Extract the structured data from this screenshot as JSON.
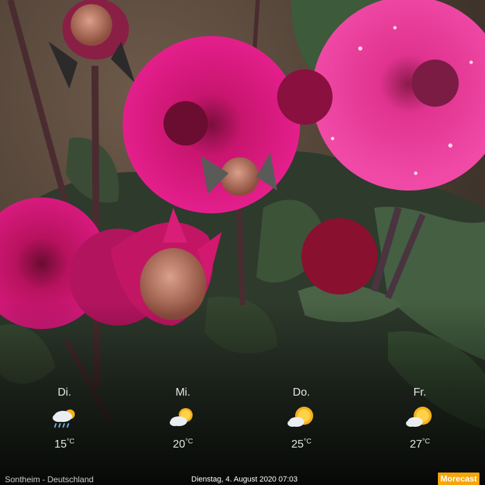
{
  "forecast": [
    {
      "day": "Di.",
      "icon": "cloud-rain-sun-icon",
      "temp": "15",
      "unit": "°C"
    },
    {
      "day": "Mi.",
      "icon": "sun-cloud-icon",
      "temp": "20",
      "unit": "°C"
    },
    {
      "day": "Do.",
      "icon": "sun-cloud-icon",
      "temp": "25",
      "unit": "°C"
    },
    {
      "day": "Fr.",
      "icon": "sun-cloud-icon",
      "temp": "27",
      "unit": "°C"
    }
  ],
  "footer": {
    "location": "Sontheim - Deutschland",
    "datetime": "Dienstag, 4. August 2020 07:03",
    "brand": "Morecast"
  },
  "colors": {
    "brand": "#f5a50a",
    "sun": "#f6b21a",
    "cloud": "#e9eef2",
    "rain": "#6fb0e0"
  }
}
